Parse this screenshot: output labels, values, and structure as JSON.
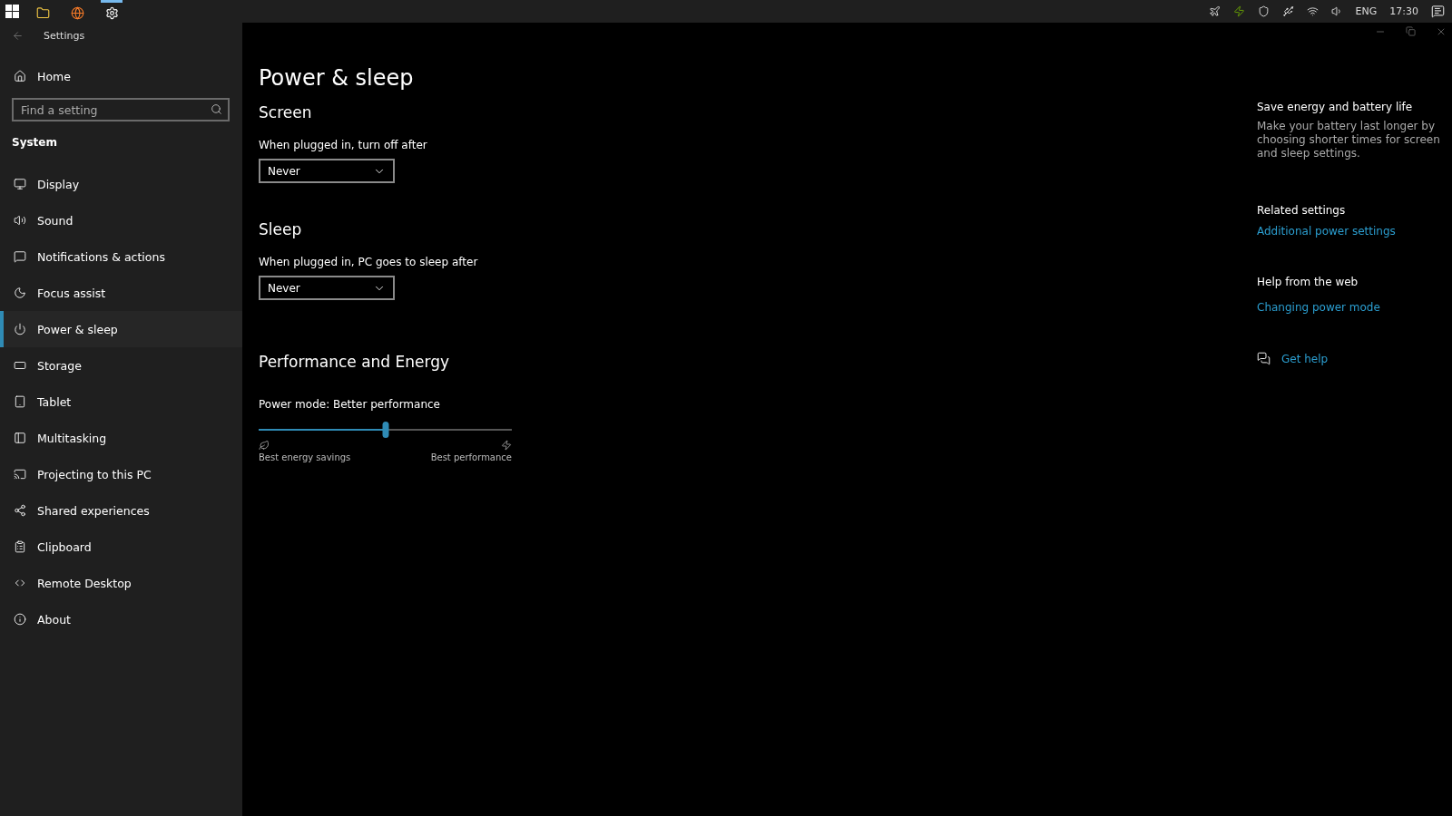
{
  "taskbar": {
    "apps": [
      {
        "kind": "folder",
        "active": false
      },
      {
        "kind": "browser",
        "active": false
      },
      {
        "kind": "gear",
        "active": true
      }
    ],
    "tray": {
      "language": "ENG",
      "time": "17:30"
    }
  },
  "window": {
    "title": "Settings"
  },
  "sidebar": {
    "home": "Home",
    "search": {
      "placeholder": "Find a setting"
    },
    "section": "System",
    "items": [
      {
        "label": "Display",
        "kind": "display",
        "selected": false
      },
      {
        "label": "Sound",
        "kind": "sound",
        "selected": false
      },
      {
        "label": "Notifications & actions",
        "kind": "notifications",
        "selected": false
      },
      {
        "label": "Focus assist",
        "kind": "focus",
        "selected": false
      },
      {
        "label": "Power & sleep",
        "kind": "power",
        "selected": true
      },
      {
        "label": "Storage",
        "kind": "storage",
        "selected": false
      },
      {
        "label": "Tablet",
        "kind": "tablet",
        "selected": false
      },
      {
        "label": "Multitasking",
        "kind": "multitasking",
        "selected": false
      },
      {
        "label": "Projecting to this PC",
        "kind": "projecting",
        "selected": false
      },
      {
        "label": "Shared experiences",
        "kind": "shared",
        "selected": false
      },
      {
        "label": "Clipboard",
        "kind": "clipboard",
        "selected": false
      },
      {
        "label": "Remote Desktop",
        "kind": "remote",
        "selected": false
      },
      {
        "label": "About",
        "kind": "about",
        "selected": false
      }
    ]
  },
  "main": {
    "title": "Power & sleep",
    "sections": [
      {
        "heading": "Screen",
        "label": "When plugged in, turn off after",
        "value": "Never"
      },
      {
        "heading": "Sleep",
        "label": "When plugged in, PC goes to sleep after",
        "value": "Never"
      }
    ],
    "performance": {
      "heading": "Performance and Energy",
      "label": "Power mode: Better performance",
      "level": 0.5,
      "min_label": "Best energy savings",
      "max_label": "Best performance"
    }
  },
  "aside": {
    "intro": {
      "title": "Save energy and battery life",
      "text": "Make your battery last longer by choosing shorter times for screen and sleep settings."
    },
    "related": {
      "title": "Related settings",
      "link": "Additional power settings"
    },
    "web": {
      "title": "Help from the web",
      "link": "Changing power mode"
    },
    "help": "Get help"
  }
}
